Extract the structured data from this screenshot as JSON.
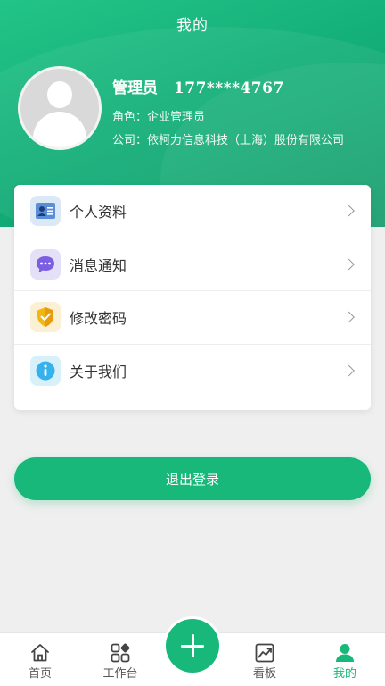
{
  "header": {
    "title": "我的",
    "user": {
      "name": "管理员",
      "phone": "177****4767",
      "role": "角色：企业管理员",
      "company": "公司：依柯力信息科技（上海）股份有限公司"
    }
  },
  "menu": {
    "items": [
      {
        "label": "个人资料",
        "icon": "profile-card-icon"
      },
      {
        "label": "消息通知",
        "icon": "message-icon"
      },
      {
        "label": "修改密码",
        "icon": "shield-icon"
      },
      {
        "label": "关于我们",
        "icon": "info-icon"
      }
    ]
  },
  "logout_label": "退出登录",
  "tabbar": {
    "tabs": [
      {
        "label": "首页",
        "icon": "home-icon"
      },
      {
        "label": "工作台",
        "icon": "grid-icon"
      },
      {
        "label": "看板",
        "icon": "chart-icon"
      },
      {
        "label": "我的",
        "icon": "person-icon",
        "active": true
      }
    ],
    "center_icon": "plus-icon"
  },
  "colors": {
    "primary": "#17b879",
    "header_start": "#23c487",
    "header_end": "#0e9a68"
  }
}
